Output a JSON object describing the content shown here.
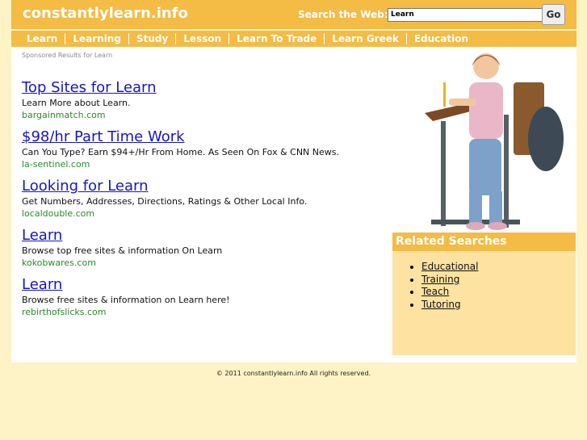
{
  "header": {
    "site_title": "constantlylearn.info",
    "search_label": "Search the Web:",
    "search_value": "Learn",
    "go_label": "Go"
  },
  "nav": [
    {
      "label": "Learn"
    },
    {
      "label": "Learning"
    },
    {
      "label": "Study"
    },
    {
      "label": "Lesson"
    },
    {
      "label": "Learn To Trade"
    },
    {
      "label": "Learn Greek"
    },
    {
      "label": "Education"
    }
  ],
  "sponsored_label": "Sponsored Results for Learn",
  "results": [
    {
      "title": "Top Sites for Learn",
      "desc": "Learn More about Learn.",
      "url": "bargainmatch.com"
    },
    {
      "title": "$98/hr Part Time Work",
      "desc": "Can You Type? Earn $94+/Hr From Home. As Seen On Fox & CNN News.",
      "url": "la-sentinel.com"
    },
    {
      "title": "Looking for Learn",
      "desc": "Get Numbers, Addresses, Directions, Ratings & Other Local Info.",
      "url": "localdouble.com"
    },
    {
      "title": "Learn",
      "desc": "Browse top free sites & information On Learn",
      "url": "kokobwares.com"
    },
    {
      "title": "Learn",
      "desc": "Browse free sites & information on Learn here!",
      "url": "rebirthofslicks.com"
    }
  ],
  "related": {
    "heading": "Related Searches",
    "items": [
      {
        "label": "Educational"
      },
      {
        "label": "Training"
      },
      {
        "label": "Teach"
      },
      {
        "label": "Tutoring"
      }
    ]
  },
  "footer": "© 2011 constantlylearn.info All rights reserved.",
  "colors": {
    "accent": "#f4bb45",
    "background": "#fdf3c6",
    "link": "#1515c8",
    "url": "#2a8a2a"
  }
}
